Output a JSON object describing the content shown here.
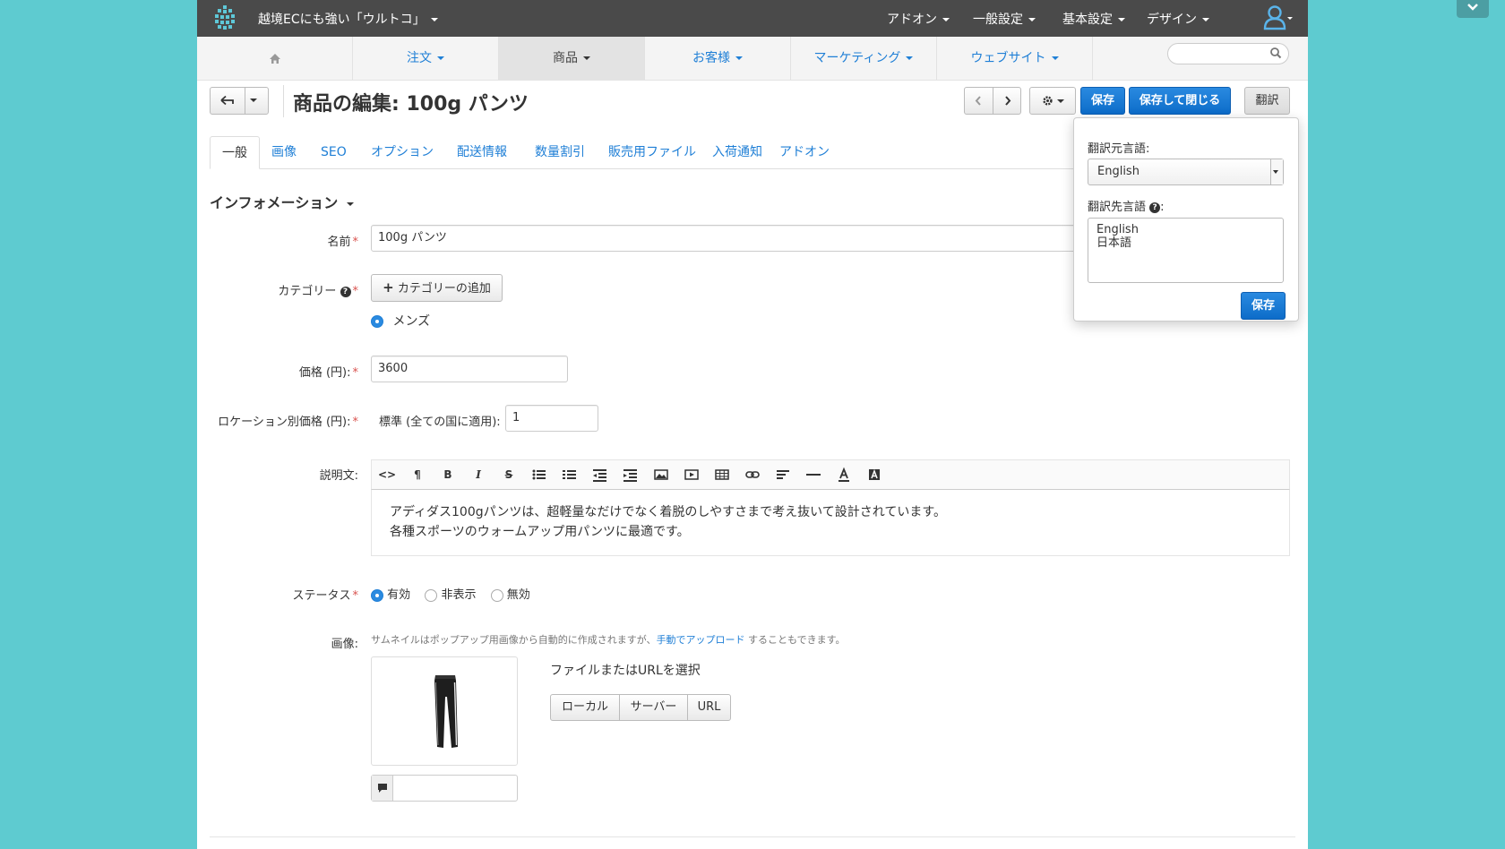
{
  "topbar": {
    "store_name": "越境ECにも強い「ウルトコ」",
    "menus": [
      "アドオン",
      "一般設定",
      "基本設定",
      "デザイン"
    ]
  },
  "nav": {
    "home_icon": "home-icon",
    "tabs": [
      "注文",
      "商品",
      "お客様",
      "マーケティング",
      "ウェブサイト"
    ],
    "active_tab": "商品",
    "search_placeholder": ""
  },
  "toolbar": {
    "title": "商品の編集: 100g パンツ",
    "save_label": "保存",
    "save_close_label": "保存して閉じる",
    "translate_label": "翻訳"
  },
  "tabs": [
    "一般",
    "画像",
    "SEO",
    "オプション",
    "配送情報",
    "数量割引",
    "販売用ファイル",
    "入荷通知",
    "アドオン"
  ],
  "section": {
    "title": "インフォメーション"
  },
  "form": {
    "name_label": "名前",
    "name_value": "100g パンツ",
    "category_label": "カテゴリー",
    "add_category_label": "カテゴリーの追加",
    "category_value": "メンズ",
    "price_label": "価格 (円):",
    "price_value": "3600",
    "location_price_label": "ロケーション別価格 (円):",
    "location_price_sublabel": "標準 (全ての国に適用):",
    "location_price_value": "1",
    "description_label": "説明文:",
    "description_lines": [
      "アディダス100gパンツは、超軽量なだけでなく着脱のしやすさまで考え抜いて設計されています。",
      "各種スポーツのウォームアップ用パンツに最適です。"
    ],
    "status_label": "ステータス",
    "status_options": [
      "有効",
      "非表示",
      "無効"
    ],
    "status_selected": "有効",
    "image_label": "画像:",
    "image_hint_before": "サムネイルはポップアップ用画像から自動的に作成されますが、",
    "image_hint_link": "手動でアップロード",
    "image_hint_after": " することもできます。",
    "file_select_title": "ファイルまたはURLを選択",
    "file_buttons": [
      "ローカル",
      "サーバー",
      "URL"
    ],
    "image_alt_value": ""
  },
  "translate_popover": {
    "source_label": "翻訳元言語:",
    "source_value": "English",
    "target_label": "翻訳先言語",
    "target_options": [
      "English",
      "日本語"
    ],
    "save_label": "保存"
  },
  "colors": {
    "accent": "#1f7fd6",
    "topbar": "#4a4a4a",
    "background": "#5ecbd0",
    "required": "#d9534f"
  }
}
